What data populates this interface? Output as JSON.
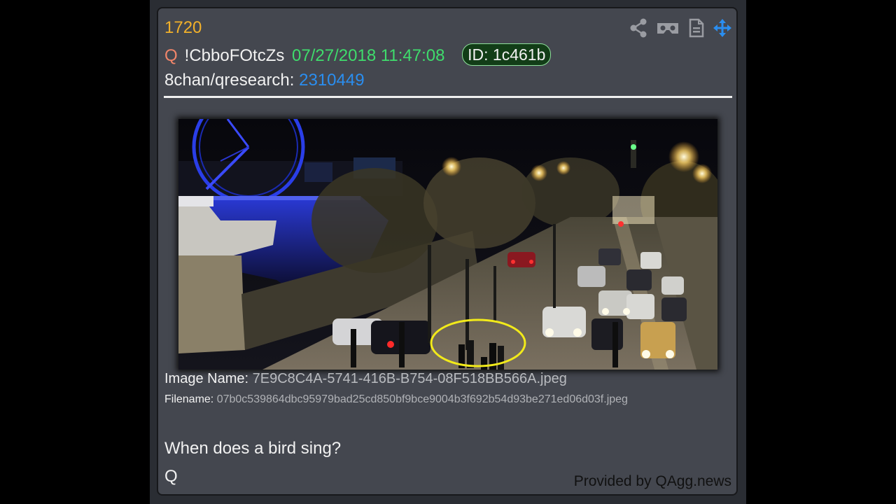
{
  "post": {
    "number": "1720",
    "trip_marker": "Q",
    "tripcode": "!CbboFOtcZs",
    "timestamp": "07/27/2018 11:47:08",
    "id_badge": "ID: 1c461b",
    "board": "8chan/qresearch:",
    "post_link": "2310449"
  },
  "toolbar": {
    "icons": [
      "share-icon",
      "vr-headset-icon",
      "document-icon",
      "move-icon"
    ],
    "colors": {
      "default": "#9a9ca2",
      "active": "#2a8ef0"
    }
  },
  "image": {
    "name_label": "Image Name:",
    "name_value": "7E9C8C4A-5741-416B-B754-08F518BB566A.jpeg",
    "filename_label": "Filename:",
    "filename_value": "07b0c539864dbc95979bad25cd850bf9bce9004b3f692b54d93be271ed06d03f.jpeg",
    "highlight_color": "#f2ea1a"
  },
  "message": {
    "text": "When does a bird sing?",
    "signature": "Q"
  },
  "footer": {
    "provider": "Provided by QAgg.news"
  },
  "colors": {
    "post_number": "#f2b12a",
    "trip_marker": "#f0856a",
    "timestamp": "#3fdc6c",
    "link": "#2a8ef0",
    "card_bg": "#44474f",
    "id_badge_bg": "#123d17"
  }
}
